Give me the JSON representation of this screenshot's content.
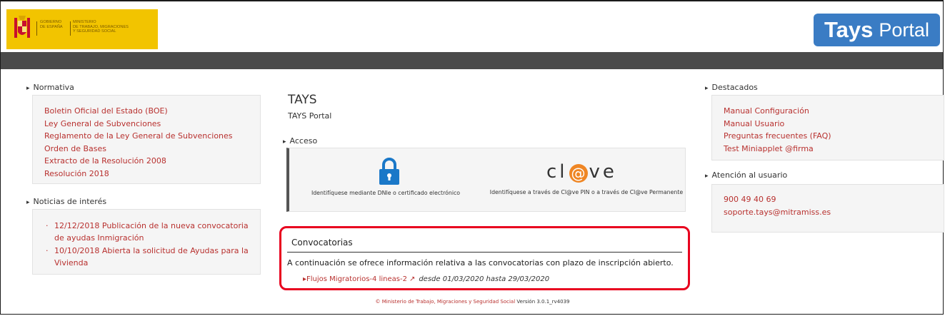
{
  "header": {
    "gov_line1": [
      "GOBIERNO",
      "DE ESPAÑA"
    ],
    "gov_line2": [
      "MINISTERIO",
      "DE TRABAJO, MIGRACIONES",
      "Y SEGURIDAD SOCIAL"
    ],
    "brand_strong": "Tays",
    "brand_light": "Portal"
  },
  "left": {
    "normativa_title": "Normativa",
    "normativa_links": [
      "Boletin Oficial del Estado (BOE)",
      "Ley General de Subvenciones",
      "Reglamento de la Ley General de Subvenciones",
      "Orden de Bases",
      "Extracto de la Resolución 2008",
      "Resolución 2018"
    ],
    "noticias_title": "Noticias de interés",
    "noticias": [
      "12/12/2018 Publicación de la nueva convocatoria de ayudas Inmigración",
      "10/10/2018 Abierta la solicitud de Ayudas para la Vivienda"
    ]
  },
  "center": {
    "title": "TAYS",
    "subtitle": "TAYS Portal",
    "acceso_title": "Acceso",
    "dnie_text": "Identifíquese mediante DNIe o certificado electrónico",
    "clave_logo_pre": "cl",
    "clave_logo_at": "@",
    "clave_logo_post": "ve",
    "clave_text": "Identifíquese a través de Cl@ve PIN o a través de Cl@ve Permanente",
    "convocatorias_title": "Convocatorias",
    "convocatorias_desc": "A continuación se ofrece información relativa a las convocatorias con plazo de inscripción abierto.",
    "convocatoria_link": "▸Flujos Migratorios-4 lineas-2",
    "convocatoria_dates": "desde 01/03/2020 hasta 29/03/2020"
  },
  "right": {
    "destacados_title": "Destacados",
    "destacados_links": [
      "Manual Configuración",
      "Manual Usuario",
      "Preguntas frecuentes (FAQ)",
      "Test Miniapplet @firma"
    ],
    "atencion_title": "Atención al usuario",
    "phone": "900 49 40 69",
    "email": "soporte.tays@mitramiss.es"
  },
  "footer": {
    "copyright": "© Ministerio de Trabajo, Migraciones y Seguridad Social",
    "version": "Versión 3.0.1_rv4039"
  },
  "colors": {
    "accent_link": "#b8312f",
    "brand_blue": "#3a7cc4",
    "gov_yellow": "#f2c400",
    "highlight_red": "#e8001e",
    "clave_orange": "#ef8624"
  }
}
